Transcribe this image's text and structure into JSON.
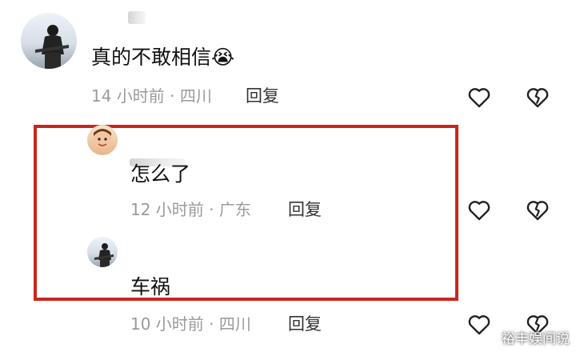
{
  "comments": [
    {
      "text": "真的不敢相信",
      "emoji": "😭",
      "time": "14 小时前",
      "location": "四川",
      "reply_label": "回复"
    },
    {
      "text": "怎么了",
      "time": "12 小时前",
      "location": "广东",
      "reply_label": "回复"
    },
    {
      "text": "车祸",
      "time": "10 小时前",
      "location": "四川",
      "reply_label": "回复"
    }
  ],
  "separator": "·",
  "watermark": "裕丰娱间说",
  "colors": {
    "highlight_border": "#c8261e",
    "meta_text": "#9a9a9a"
  },
  "icons": [
    "like-heart-icon",
    "dislike-broken-heart-icon"
  ]
}
